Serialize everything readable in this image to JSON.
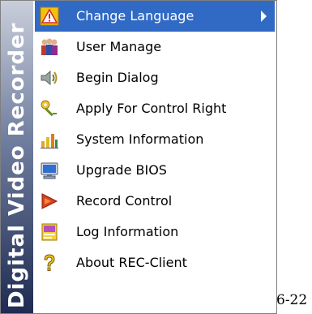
{
  "banner": {
    "text": "Digital Video Recorder"
  },
  "menu": {
    "items": [
      {
        "label": "Change Language",
        "icon": "warning-icon",
        "selected": true,
        "has_submenu": true
      },
      {
        "label": "User Manage",
        "icon": "users-icon"
      },
      {
        "label": "Begin Dialog",
        "icon": "speaker-icon"
      },
      {
        "label": "Apply For Control Right",
        "icon": "key-icon"
      },
      {
        "label": "System Information",
        "icon": "system-info-icon"
      },
      {
        "label": "Upgrade BIOS",
        "icon": "monitor-icon"
      },
      {
        "label": "Record Control",
        "icon": "record-icon"
      },
      {
        "label": "Log Information",
        "icon": "log-icon"
      },
      {
        "label": "About REC-Client",
        "icon": "help-icon"
      }
    ]
  },
  "figure_label": "6-22",
  "colors": {
    "highlight": "#316ac5",
    "banner_dark": "#1f2b52",
    "border": "#7f7f7f"
  }
}
